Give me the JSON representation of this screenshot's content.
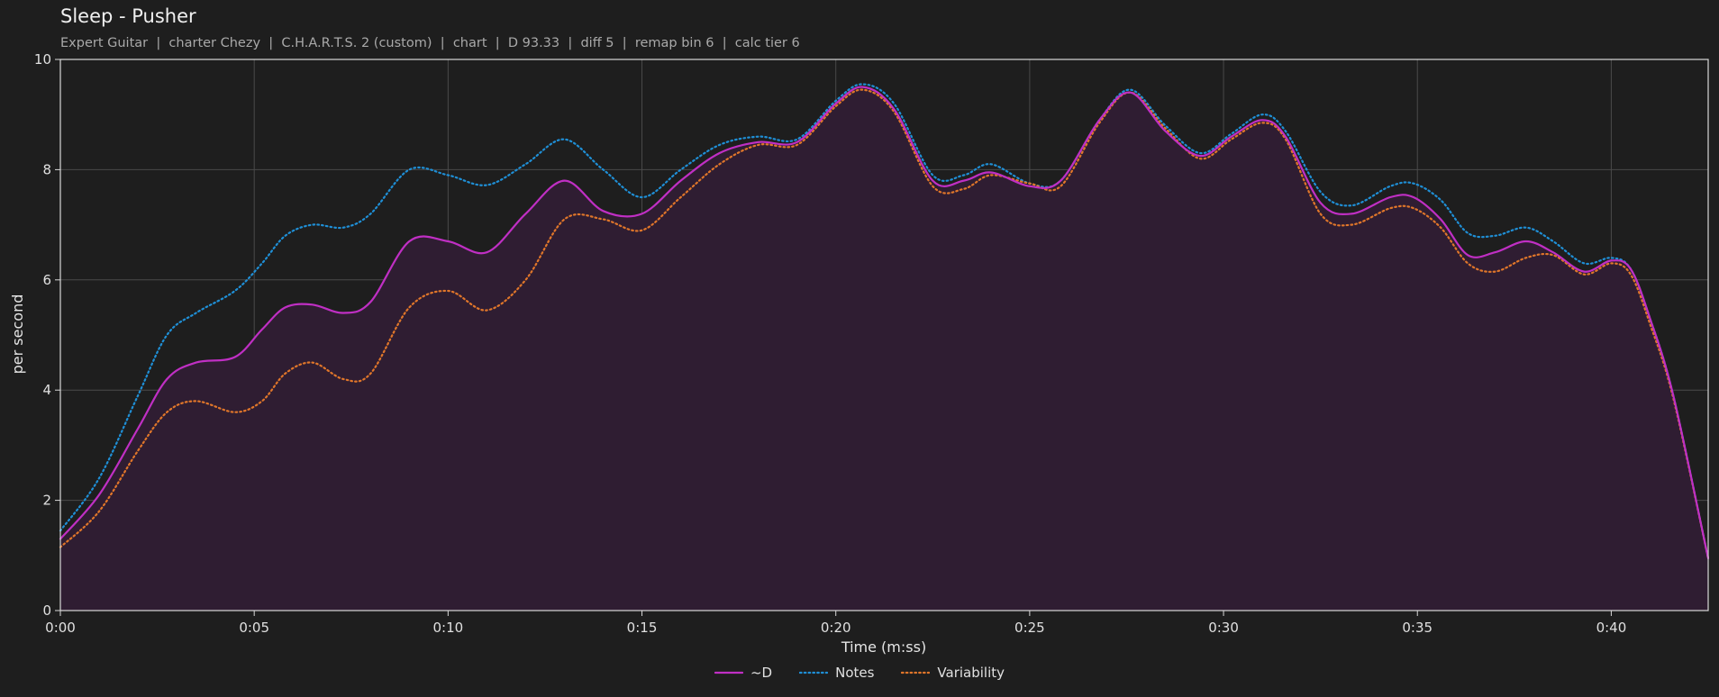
{
  "title": "Sleep - Pusher",
  "subtitle": "Expert Guitar  |  charter Chezy  |  C.H.A.R.T.S. 2 (custom)  |  chart  |  D 93.33  |  diff 5  |  remap bin 6  |  calc tier 6",
  "colors": {
    "background": "#1e1e1e",
    "fill": "#2f1d32",
    "grid": "#4a4a4a",
    "spine": "#d9d9d9",
    "d_line": "#c02fc4",
    "notes_line": "#1f8fd6",
    "variability_line": "#e0762a"
  },
  "chart_data": {
    "type": "line",
    "title": "Sleep - Pusher",
    "xlabel": "Time (m:ss)",
    "ylabel": "per second",
    "xlim": [
      0,
      42.5
    ],
    "ylim": [
      0,
      10
    ],
    "grid": true,
    "legend_position": "bottom-center",
    "xticks": [
      {
        "value": 0,
        "label": "0:00"
      },
      {
        "value": 5,
        "label": "0:05"
      },
      {
        "value": 10,
        "label": "0:10"
      },
      {
        "value": 15,
        "label": "0:15"
      },
      {
        "value": 20,
        "label": "0:20"
      },
      {
        "value": 25,
        "label": "0:25"
      },
      {
        "value": 30,
        "label": "0:30"
      },
      {
        "value": 35,
        "label": "0:35"
      },
      {
        "value": 40,
        "label": "0:40"
      }
    ],
    "yticks": [
      {
        "value": 0,
        "label": "0"
      },
      {
        "value": 2,
        "label": "2"
      },
      {
        "value": 4,
        "label": "4"
      },
      {
        "value": 6,
        "label": "6"
      },
      {
        "value": 8,
        "label": "8"
      },
      {
        "value": 10,
        "label": "10"
      }
    ],
    "x": [
      0,
      1,
      2,
      2.75,
      3.5,
      4.5,
      5.2,
      5.8,
      6.5,
      7.3,
      8,
      9,
      10,
      11,
      12,
      13,
      14,
      15,
      16,
      17,
      18,
      19,
      20,
      20.7,
      21.5,
      22.5,
      23.3,
      24,
      25,
      25.8,
      26.8,
      27.6,
      28.5,
      29.4,
      30.2,
      31,
      31.6,
      32.5,
      33.3,
      34.3,
      34.9,
      35.6,
      36.3,
      37,
      37.8,
      38.5,
      39.3,
      40,
      40.5,
      41,
      41.6,
      42.5
    ],
    "series": [
      {
        "name": "~D",
        "style": "solid",
        "values": [
          1.3,
          2.1,
          3.3,
          4.2,
          4.5,
          4.6,
          5.1,
          5.5,
          5.55,
          5.4,
          5.6,
          6.7,
          6.7,
          6.5,
          7.2,
          7.8,
          7.25,
          7.2,
          7.8,
          8.3,
          8.5,
          8.5,
          9.2,
          9.5,
          9.1,
          7.8,
          7.8,
          7.95,
          7.7,
          7.8,
          8.9,
          9.4,
          8.7,
          8.25,
          8.6,
          8.9,
          8.6,
          7.4,
          7.2,
          7.5,
          7.5,
          7.1,
          6.45,
          6.5,
          6.7,
          6.5,
          6.15,
          6.35,
          6.2,
          5.3,
          3.9,
          0.95
        ]
      },
      {
        "name": "Notes",
        "style": "dotted",
        "values": [
          1.45,
          2.4,
          3.9,
          5.0,
          5.4,
          5.8,
          6.3,
          6.8,
          7.0,
          6.95,
          7.2,
          8.0,
          7.9,
          7.72,
          8.1,
          8.55,
          8.0,
          7.5,
          8.0,
          8.45,
          8.6,
          8.55,
          9.25,
          9.55,
          9.2,
          7.9,
          7.9,
          8.1,
          7.75,
          7.8,
          8.9,
          9.45,
          8.8,
          8.3,
          8.65,
          9.0,
          8.7,
          7.6,
          7.35,
          7.7,
          7.75,
          7.45,
          6.85,
          6.8,
          6.95,
          6.7,
          6.3,
          6.4,
          6.2,
          5.3,
          3.9,
          0.95
        ]
      },
      {
        "name": "Variability",
        "style": "dotted",
        "values": [
          1.15,
          1.8,
          2.9,
          3.6,
          3.8,
          3.6,
          3.8,
          4.3,
          4.5,
          4.2,
          4.3,
          5.5,
          5.8,
          5.45,
          6.0,
          7.1,
          7.1,
          6.9,
          7.5,
          8.1,
          8.45,
          8.45,
          9.15,
          9.45,
          9.05,
          7.7,
          7.65,
          7.9,
          7.75,
          7.7,
          8.85,
          9.4,
          8.75,
          8.2,
          8.55,
          8.85,
          8.55,
          7.2,
          7.0,
          7.3,
          7.3,
          6.95,
          6.3,
          6.15,
          6.4,
          6.45,
          6.1,
          6.3,
          6.1,
          5.2,
          3.85,
          0.95
        ]
      }
    ]
  }
}
